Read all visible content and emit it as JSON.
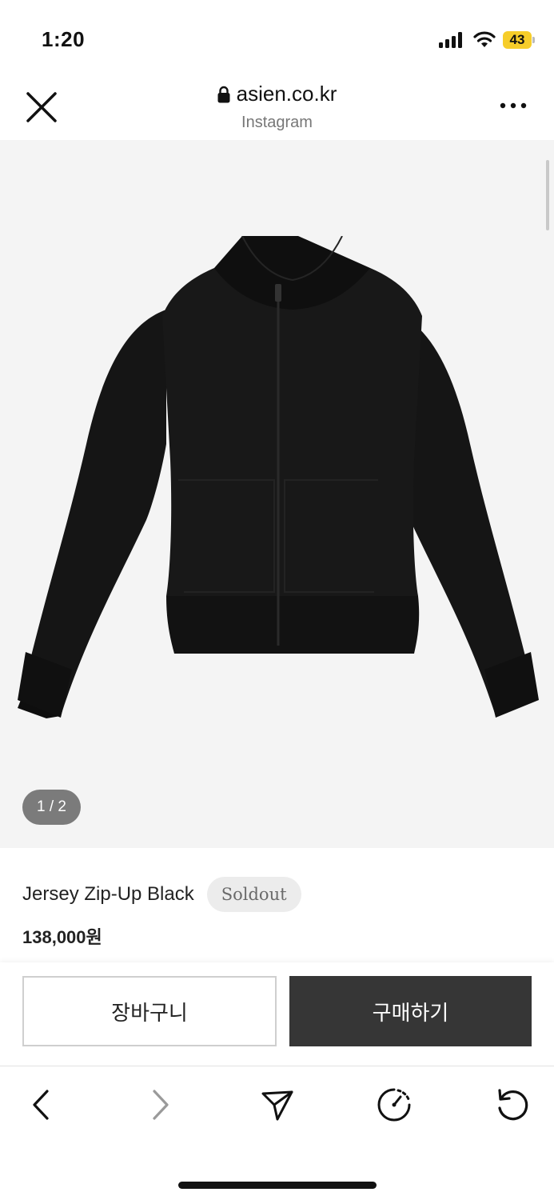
{
  "status_bar": {
    "time": "1:20",
    "battery_level": "43",
    "battery_color": "#f6cd2a",
    "icons": [
      "signal-icon",
      "wifi-icon",
      "battery-icon"
    ]
  },
  "browser_header": {
    "url": "asien.co.kr",
    "source": "Instagram",
    "icons": [
      "close-icon",
      "lock-icon",
      "more-icon"
    ]
  },
  "product": {
    "image_alt_icon": "jacket-image",
    "page_indicator": "1 / 2",
    "name": "Jersey Zip-Up Black",
    "badge": "Soldout",
    "price": "138,000원"
  },
  "actions": {
    "cart_label": "장바구니",
    "buy_label": "구매하기",
    "buy_color": "#363636"
  },
  "toolbar": {
    "icons": [
      "back-icon",
      "forward-icon",
      "share-icon",
      "speed-icon",
      "refresh-icon"
    ]
  }
}
